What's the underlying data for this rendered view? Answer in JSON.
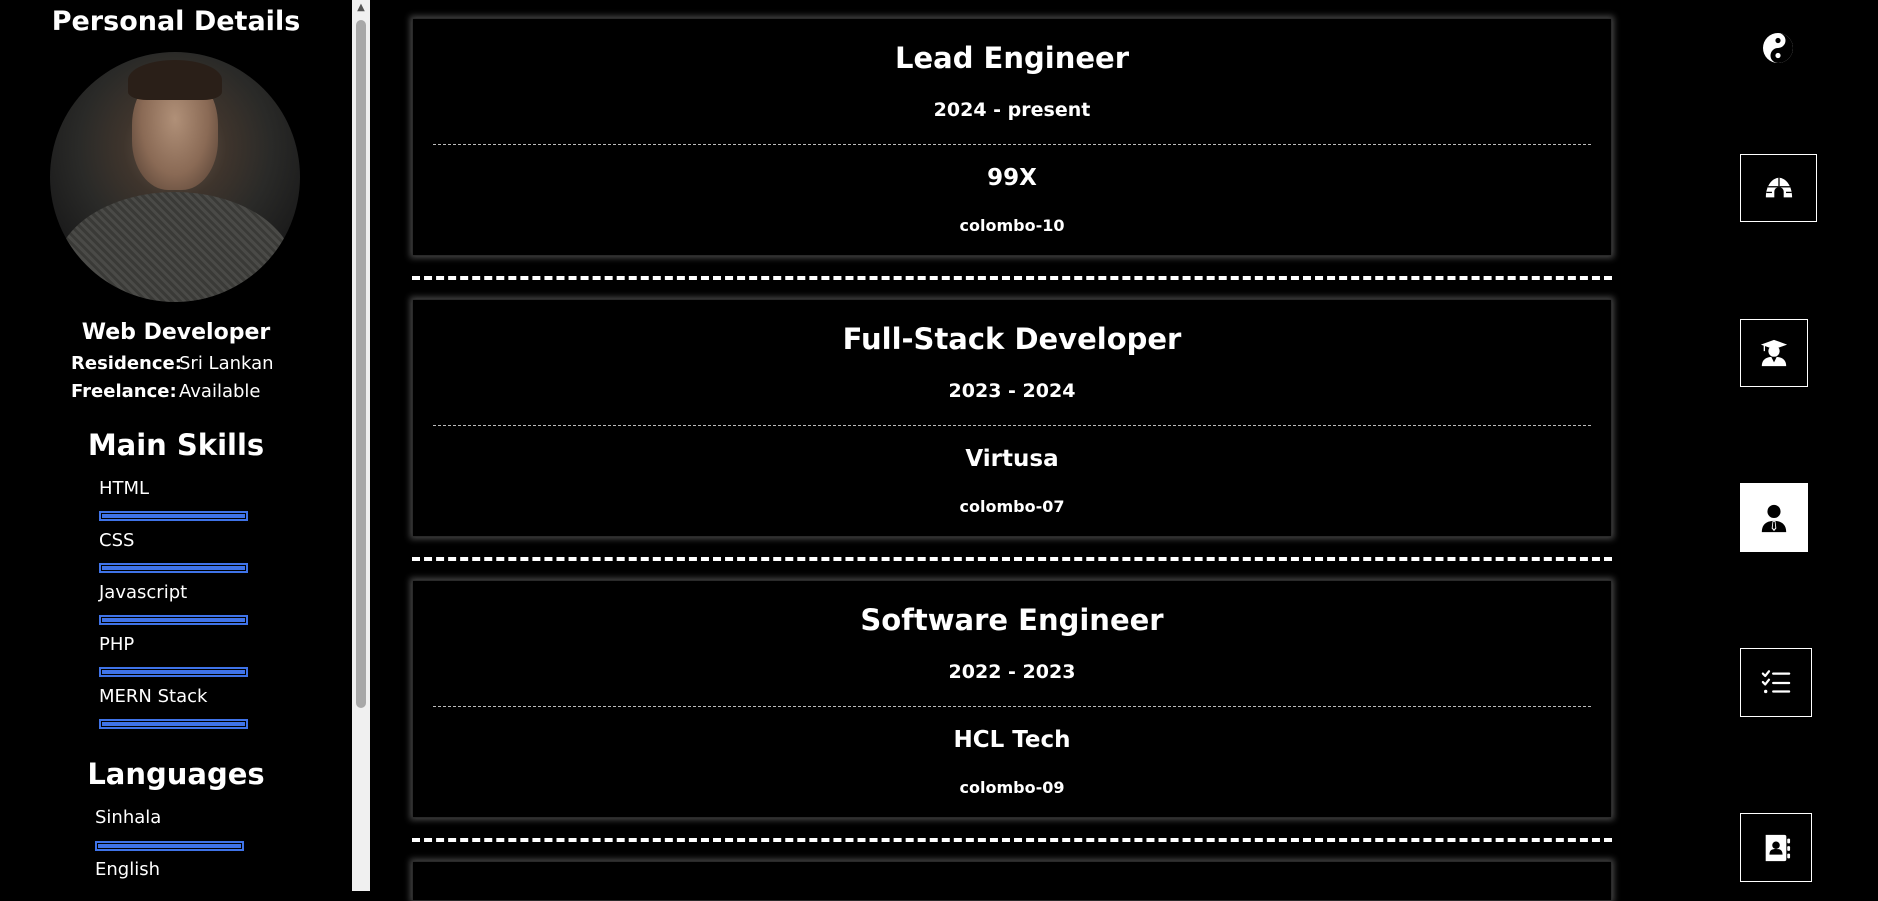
{
  "sidebar": {
    "title": "Personal Details",
    "role": "Web Developer",
    "residence_label": "Residence:",
    "residence_value": "Sri Lankan",
    "freelance_label": "Freelance:",
    "freelance_value": "Available",
    "skills_title": "Main Skills",
    "skills": [
      {
        "name": "HTML",
        "level": 1.0
      },
      {
        "name": "CSS",
        "level": 1.0
      },
      {
        "name": "Javascript",
        "level": 1.0
      },
      {
        "name": "PHP",
        "level": 1.0
      },
      {
        "name": "MERN Stack",
        "level": 1.0
      }
    ],
    "languages_title": "Languages",
    "languages": [
      {
        "name": "Sinhala",
        "level": 1.0
      },
      {
        "name": "English",
        "level": null
      }
    ]
  },
  "experience": [
    {
      "title": "Lead Engineer",
      "period": "2024 - present",
      "company": "99X",
      "location": "colombo-10"
    },
    {
      "title": "Full-Stack Developer",
      "period": "2023 - 2024",
      "company": "Virtusa",
      "location": "colombo-07"
    },
    {
      "title": "Software Engineer",
      "period": "2022 - 2023",
      "company": "HCL Tech",
      "location": "colombo-09"
    }
  ],
  "nav": {
    "theme_icon": "yin-yang-icon",
    "items": [
      {
        "name": "home",
        "icon": "igloo-icon",
        "active": false
      },
      {
        "name": "education",
        "icon": "graduate-icon",
        "active": false
      },
      {
        "name": "experience",
        "icon": "user-tie-icon",
        "active": true
      },
      {
        "name": "skills",
        "icon": "list-check-icon",
        "active": false
      },
      {
        "name": "contact",
        "icon": "address-book-icon",
        "active": false
      }
    ]
  },
  "colors": {
    "background": "#000000",
    "skill_bar": "#3f73e8",
    "text": "#ffffff"
  }
}
